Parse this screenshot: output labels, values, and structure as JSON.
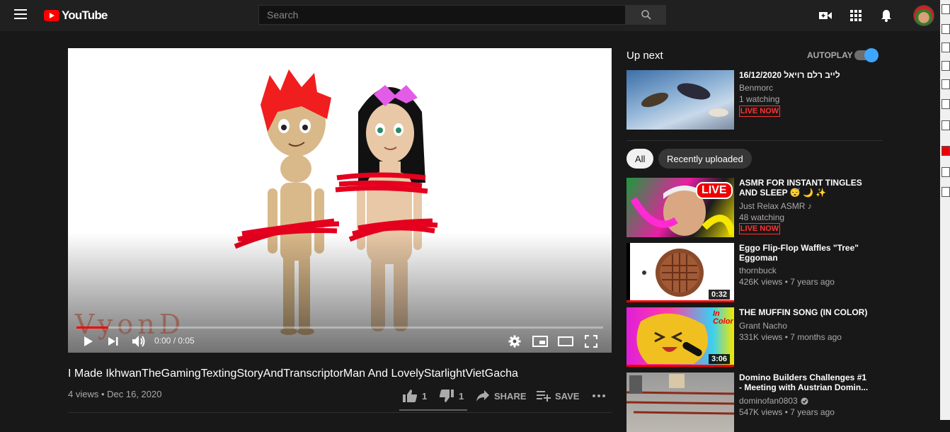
{
  "header": {
    "logo_text": "YouTube",
    "search_placeholder": "Search"
  },
  "player": {
    "watermark": "VyonD",
    "time": "0:00 / 0:05",
    "progress_fraction": 0.06
  },
  "video": {
    "title": "I Made IkhwanTheGamingTextingStoryAndTranscriptorMan And LovelyStarlightVietGacha",
    "meta": "4 views • Dec 16, 2020",
    "likes": "1",
    "dislikes": "1",
    "share_label": "SHARE",
    "save_label": "SAVE"
  },
  "sidebar": {
    "up_next": "Up next",
    "autoplay": "AUTOPLAY",
    "chips": [
      "All",
      "Recently uploaded"
    ],
    "items": [
      {
        "title": "16/12/2020 לייב רלם רויאל",
        "channel": "Benmorc",
        "meta": "1 watching",
        "badge": "LIVE NOW"
      },
      {
        "title": "ASMR FOR INSTANT TINGLES AND SLEEP 😴 🌙 ✨",
        "channel": "Just Relax ASMR ♪",
        "meta": "48 watching",
        "badge": "LIVE NOW",
        "thumb_badge": "LIVE"
      },
      {
        "title": "Eggo Flip-Flop Waffles \"Tree\" Eggoman",
        "channel": "thornbuck",
        "meta": "426K views • 7 years ago",
        "duration": "0:32"
      },
      {
        "title": "THE MUFFIN SONG (IN COLOR)",
        "channel": "Grant Nacho",
        "meta": "331K views • 7 months ago",
        "duration": "3:06",
        "thumb_text": "In Color"
      },
      {
        "title": "Domino Builders Challenges #1 - Meeting with Austrian Domin...",
        "channel": "dominofan0803",
        "meta": "547K views • 7 years ago"
      }
    ]
  },
  "colors": {
    "background": "#181818",
    "masthead": "#202020",
    "accent_red": "#ff0000",
    "toggle_blue": "#3ea6ff"
  }
}
